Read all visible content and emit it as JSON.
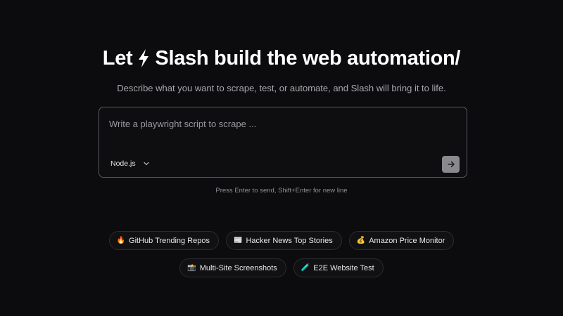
{
  "hero": {
    "headline_before": "Let",
    "headline_after": "Slash build the web automation/",
    "subtitle": "Describe what you want to scrape, test, or automate, and Slash will bring it to life."
  },
  "composer": {
    "placeholder": "Write a playwright script to scrape ...",
    "value": "",
    "language": "Node.js",
    "send_icon": "arrow-right-icon"
  },
  "hint": "Press Enter to send, Shift+Enter for new line",
  "suggestions": {
    "row1": [
      {
        "emoji": "🔥",
        "label": "GitHub Trending Repos"
      },
      {
        "emoji": "📰",
        "label": "Hacker News Top Stories"
      },
      {
        "emoji": "💰",
        "label": "Amazon Price Monitor"
      }
    ],
    "row2": [
      {
        "emoji": "📸",
        "label": "Multi-Site Screenshots"
      },
      {
        "emoji": "🧪",
        "label": "E2E Website Test"
      }
    ]
  },
  "colors": {
    "background": "#0c0c0e",
    "border": "#5a5a60",
    "send_button": "#8a8a8e"
  }
}
